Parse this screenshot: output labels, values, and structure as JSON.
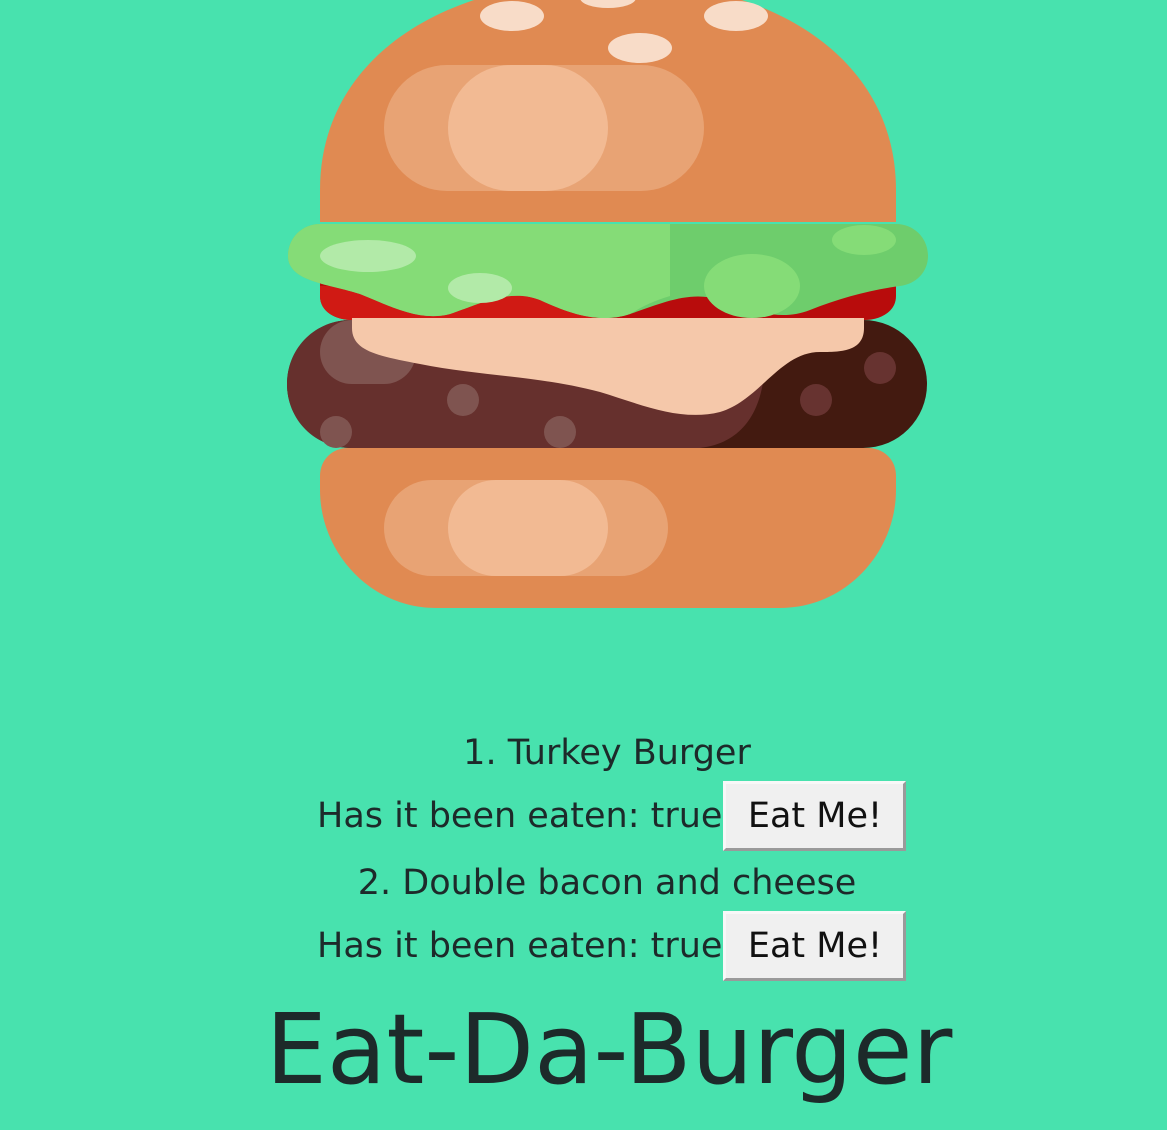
{
  "page": {
    "title": "Eat-Da-Burger",
    "background_color": "#48e2ae"
  },
  "hero_image": {
    "icon": "burger-illustration"
  },
  "burgers": [
    {
      "name": "1. Turkey Burger",
      "eaten_label": "Has it been eaten: true",
      "button_label": "Eat Me!"
    },
    {
      "name": "2. Double bacon and cheese",
      "eaten_label": "Has it been eaten: true",
      "button_label": "Eat Me!"
    }
  ]
}
